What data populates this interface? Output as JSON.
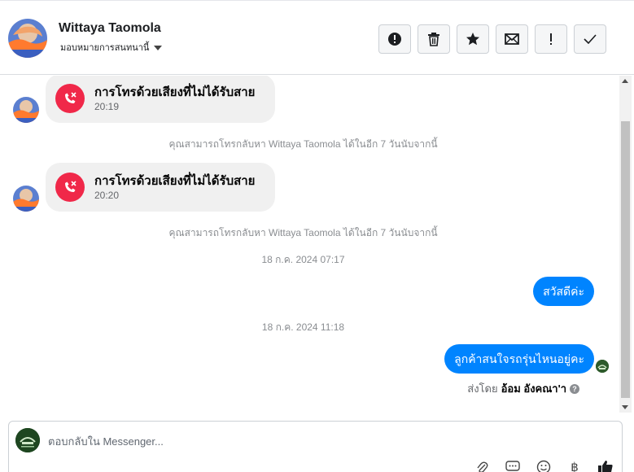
{
  "header": {
    "contact_name": "Wittaya Taomola",
    "assign_label": "มอบหมายการสนทนานี้"
  },
  "toolbar": [
    {
      "name": "mark-spam-button",
      "icon": "alert-circle-icon"
    },
    {
      "name": "delete-button",
      "icon": "trash-icon"
    },
    {
      "name": "star-button",
      "icon": "star-icon"
    },
    {
      "name": "mark-unread-button",
      "icon": "envelope-icon"
    },
    {
      "name": "follow-up-button",
      "icon": "exclamation-icon"
    },
    {
      "name": "mark-done-button",
      "icon": "check-icon"
    }
  ],
  "thread": {
    "messages": [
      {
        "type": "missed_call",
        "title": "การโทรด้วยเสียงที่ไม่ได้รับสาย",
        "time": "20:19"
      },
      {
        "type": "system",
        "text": "คุณสามารถโทรกลับหา Wittaya Taomola ได้ในอีก 7 วันนับจากนี้"
      },
      {
        "type": "missed_call",
        "title": "การโทรด้วยเสียงที่ไม่ได้รับสาย",
        "time": "20:20"
      },
      {
        "type": "system",
        "text": "คุณสามารถโทรกลับหา Wittaya Taomola ได้ในอีก 7 วันนับจากนี้"
      },
      {
        "type": "timestamp",
        "text": "18 ก.ค. 2024 07:17"
      },
      {
        "type": "outgoing",
        "text": "สวัสดีค่ะ"
      },
      {
        "type": "timestamp",
        "text": "18 ก.ค. 2024 11:18"
      },
      {
        "type": "outgoing",
        "text": "ลูกค้าสนใจรถรุ่นไหนอยู่คะ"
      }
    ],
    "sent_by_prefix": "ส่งโดย",
    "sent_by_name": "อ้อม อังคณา'า"
  },
  "composer": {
    "placeholder": "ตอบกลับใน Messenger..."
  },
  "colors": {
    "accent": "#0084ff",
    "missed_call": "#f02849"
  }
}
